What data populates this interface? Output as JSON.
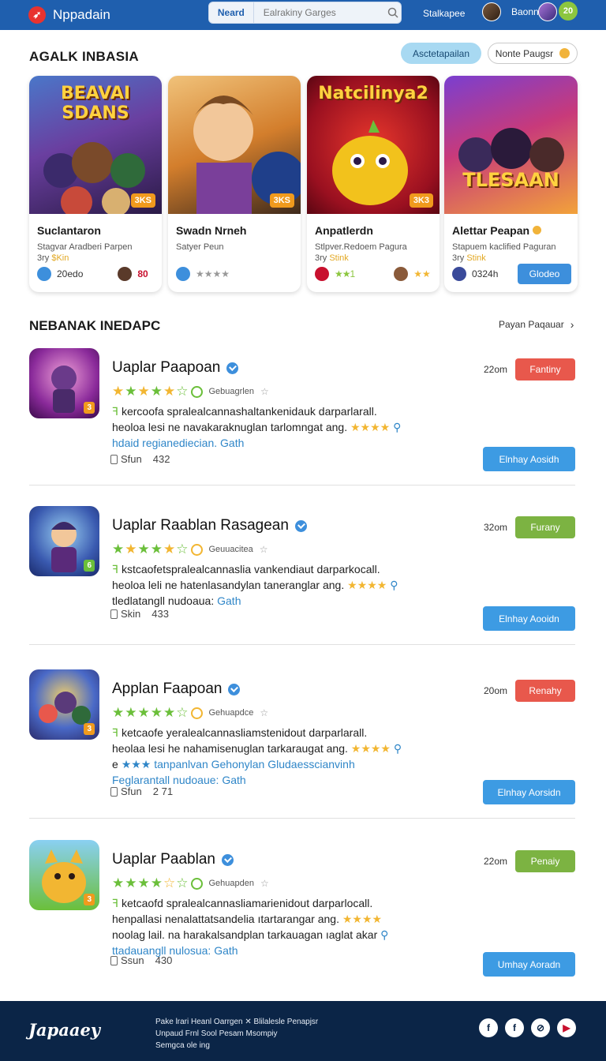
{
  "header": {
    "app_name": "Nppadain",
    "search": {
      "tab": "Neard",
      "placeholder": "Ealrakiny Garges"
    },
    "link": "Stalkapee",
    "user_name": "Baonn",
    "badge": "20"
  },
  "section1": {
    "title": "AGALK INBASIA",
    "primary_button": "Asctetapailan",
    "secondary_button": "Nonte Paugsr",
    "cards": [
      {
        "art": "BEAVAI SDANS",
        "tag": "3KS",
        "title": "Suclantaron",
        "sub1": "Stagvar Aradberi Parpen",
        "sub2a": "3ry ",
        "sub2b": "$Kin",
        "foot": "20edo",
        "foot2": "80"
      },
      {
        "art": "",
        "tag": "3KS",
        "title": "Swadn Nrneh",
        "sub1": "Satyer Peun",
        "sub2a": "",
        "sub2b": "",
        "foot": "★★★★",
        "foot2": ""
      },
      {
        "art": "Natcilinya2",
        "tag": "3K3",
        "title": "Anpatlerdn",
        "sub1": "Stlpver.Redoem Pagura",
        "sub2a": "3ry ",
        "sub2b": "Stink",
        "foot": "★★1",
        "foot2": "★★"
      },
      {
        "art": "TLESAAN",
        "tag": "",
        "title": "Alettar Peapan",
        "sub1": "Stapuem kaclified Paguran",
        "sub2a": "3ry ",
        "sub2b": "Stink",
        "foot": "0324h",
        "button": "Glodeo"
      }
    ]
  },
  "section2": {
    "title": "NEBANAK INEDAPC",
    "more": "Payan Paqauar",
    "rating_label": "Gebuagrlen",
    "rows": [
      {
        "title": "Uaplar Paapoan",
        "rating_label": "Gebuagrlen",
        "line1": "kercoofa spralealcannashaltankenidauk darparlarall.",
        "line2a": "heoloa lesi ne navakaraknuglan tarlomngat ang.",
        "line2b": "★★★★",
        "line3a": "hdaid",
        "line3b": "regianediecian.",
        "line3c": "Gath",
        "line4": "",
        "meta_label": "Sfun",
        "meta_count": "432",
        "time": "22om",
        "tag": "Fantiny",
        "tag_color": "#e8584c",
        "action": "Elnhay Aosidh"
      },
      {
        "title": "Uaplar Raablan Rasagean",
        "rating_label": "Geuuacitea",
        "line1": "kstcaofetspralealcannaslia vankendiaut darparkocall.",
        "line2a": "heoloa leli ne hatenlasandylan taneranglar ang.",
        "line2b": "★★★★",
        "line3a": "",
        "line3b": "tledlatangll nudoaua:",
        "line3c": "Gath",
        "line4": "",
        "meta_label": "Skin",
        "meta_count": "433",
        "time": "32om",
        "tag": "Furany",
        "tag_color": "#7cb342",
        "action": "Elnhay Aooidn"
      },
      {
        "title": "Applan Faapoan",
        "rating_label": "Gehuapdce",
        "line1": "ketcaofe yeralealcannasliamstenidout darparlarall.",
        "line2a": "heolaa lesi he nahamisenuglan tarkaraugat ang.",
        "line2b": "★★★★",
        "line3a": "e",
        "line3b": "★★★ tanpanlvan Gehonylan Gludaesscianvinh",
        "line3c": "",
        "line4": "Feglarantall nudoaue: Gath",
        "meta_label": "Sfun",
        "meta_count": "2 71",
        "time": "20om",
        "tag": "Renahy",
        "tag_color": "#e8584c",
        "action": "Elnhay Aorsidn"
      },
      {
        "title": "Uaplar Paablan",
        "rating_label": "Gehuapden",
        "line1": "ketcaofd spralealcannasliamarienidout darparlocall.",
        "line2a": "henpallasi nenalattatsandelia ıtartarangar ang.",
        "line2b": "★★★★",
        "line3a": "",
        "line3b": "noolag lail. na harakalsandplan tarkauagan ıaglat akar",
        "line3c": "",
        "line4": "ttadauangll nulosua: Gath",
        "meta_label": "Ssun",
        "meta_count": "430",
        "time": "22om",
        "tag": "Penaiy",
        "tag_color": "#7cb342",
        "action": "Umhay Aoradn"
      }
    ]
  },
  "footer": {
    "logo": "Japaaey",
    "links1": "Pake lrari Heanl Oarrgen  ✕  Blilalesle Penapjsr",
    "links2": "Unpaud Frnl Sool Pesam Msompiy",
    "links3": "Semgca ole ing"
  }
}
